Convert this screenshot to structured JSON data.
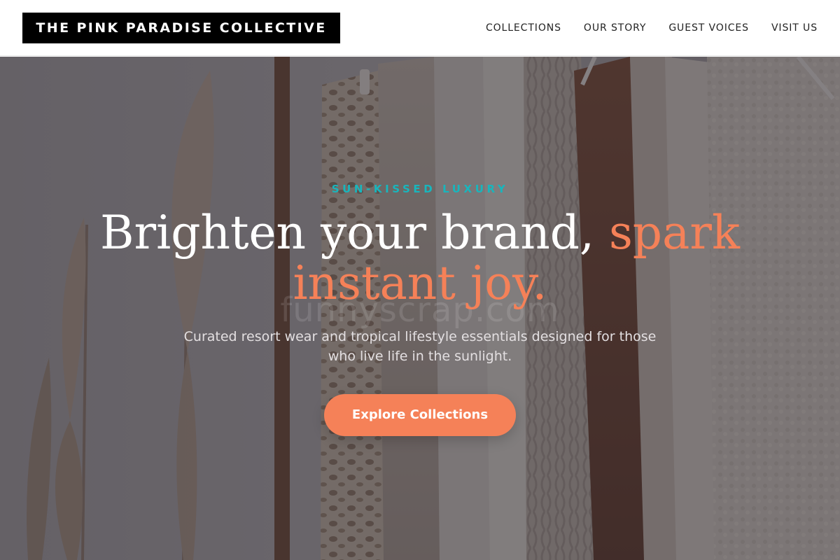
{
  "header": {
    "logo_text": "THE PINK PARADISE COLLECTIVE",
    "nav": [
      {
        "label": "COLLECTIONS"
      },
      {
        "label": "OUR STORY"
      },
      {
        "label": "GUEST VOICES"
      },
      {
        "label": "VISIT US"
      }
    ]
  },
  "hero": {
    "eyebrow": "SUN-KISSED LUXURY",
    "headline_main": "Brighten your brand, ",
    "headline_accent": "spark instant joy.",
    "subtext": "Curated resort wear and tropical lifestyle essentials designed for those who live life in the sunlight.",
    "cta_label": "Explore Collections",
    "watermark": "funnyscrap.com"
  },
  "colors": {
    "accent": "#f58158",
    "eyebrow": "#18b6bd",
    "logo_bg": "#000000",
    "header_bg": "#ffffff"
  }
}
